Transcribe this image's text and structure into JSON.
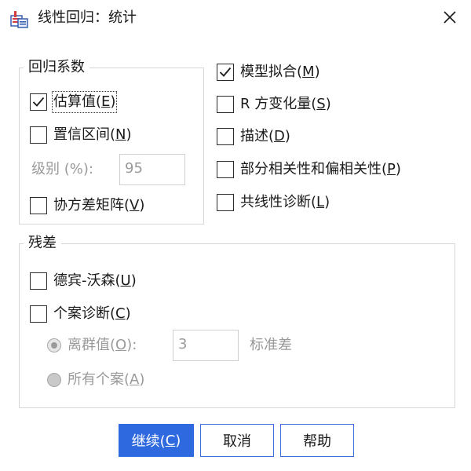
{
  "window": {
    "title": "线性回归：统计",
    "close_symbol": "✕"
  },
  "regression_coefficients": {
    "legend": "回归系数",
    "estimates": {
      "label_pre": "估算值(",
      "mnemonic": "E",
      "label_post": ")",
      "checked": true
    },
    "confidence_intervals": {
      "label_pre": "置信区间(",
      "mnemonic": "N",
      "label_post": ")",
      "checked": false
    },
    "level_label": "级别 (%):",
    "level_value": "95",
    "covariance_matrix": {
      "label_pre": "协方差矩阵(",
      "mnemonic": "V",
      "label_post": ")",
      "checked": false
    }
  },
  "right_options": {
    "model_fit": {
      "label_pre": "模型拟合(",
      "mnemonic": "M",
      "label_post": ")",
      "checked": true
    },
    "r_squared_change": {
      "label_pre": "R 方变化量(",
      "mnemonic": "S",
      "label_post": ")",
      "checked": false
    },
    "descriptives": {
      "label_pre": "描述(",
      "mnemonic": "D",
      "label_post": ")",
      "checked": false
    },
    "part_partial_correlations": {
      "label_pre": "部分相关性和偏相关性(",
      "mnemonic": "P",
      "label_post": ")",
      "checked": false
    },
    "collinearity_diagnostics": {
      "label_pre": "共线性诊断(",
      "mnemonic": "L",
      "label_post": ")",
      "checked": false
    }
  },
  "residuals": {
    "legend": "残差",
    "durbin_watson": {
      "label_pre": "德宾-沃森(",
      "mnemonic": "U",
      "label_post": ")",
      "checked": false
    },
    "casewise_diagnostics": {
      "label_pre": "个案诊断(",
      "mnemonic": "C",
      "label_post": ")",
      "checked": false
    },
    "outliers": {
      "label_pre": "离群值(",
      "mnemonic": "O",
      "label_post": "):",
      "selected": true,
      "value": "3",
      "unit": "标准差"
    },
    "all_cases": {
      "label_pre": "所有个案(",
      "mnemonic": "A",
      "label_post": ")",
      "selected": false
    }
  },
  "buttons": {
    "continue": {
      "label_pre": "继续(",
      "mnemonic": "C",
      "label_post": ")"
    },
    "cancel": "取消",
    "help": "帮助"
  },
  "colors": {
    "accent": "#2f69e0",
    "border": "#d7d7d7",
    "disabled": "#9a9a9a"
  }
}
